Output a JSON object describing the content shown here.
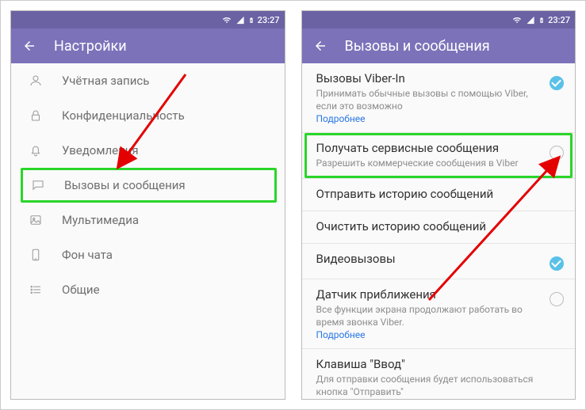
{
  "status": {
    "time": "23:27"
  },
  "left": {
    "title": "Настройки",
    "items": [
      {
        "icon": "user-icon",
        "label": "Учётная запись"
      },
      {
        "icon": "lock-icon",
        "label": "Конфиденциальность"
      },
      {
        "icon": "bell-icon",
        "label": "Уведомления"
      },
      {
        "icon": "chat-icon",
        "label": "Вызовы и сообщения"
      },
      {
        "icon": "media-icon",
        "label": "Мультимедиа"
      },
      {
        "icon": "phone-icon",
        "label": "Фон чата"
      },
      {
        "icon": "list-icon",
        "label": "Общие"
      }
    ]
  },
  "right": {
    "title": "Вызовы и сообщения",
    "rows": {
      "viberin": {
        "title": "Вызовы Viber-In",
        "sub": "Принимать обычные вызовы с помощью Viber, если это возможно",
        "link": "Подробнее"
      },
      "service": {
        "title": "Получать сервисные сообщения",
        "sub": "Разрешить коммерческие сообщения в Viber"
      },
      "send_history": {
        "title": "Отправить историю сообщений"
      },
      "clear_history": {
        "title": "Очистить историю сообщений"
      },
      "video": {
        "title": "Видеовызовы"
      },
      "proximity": {
        "title": "Датчик приближения",
        "sub": "Все функции экрана продолжают работать во время звонка Viber.",
        "link": "Подробнее"
      },
      "enter": {
        "title": "Клавиша \"Ввод\"",
        "sub": "Для отправки сообщения будет использоваться кнопка \"Отправить\""
      }
    }
  }
}
